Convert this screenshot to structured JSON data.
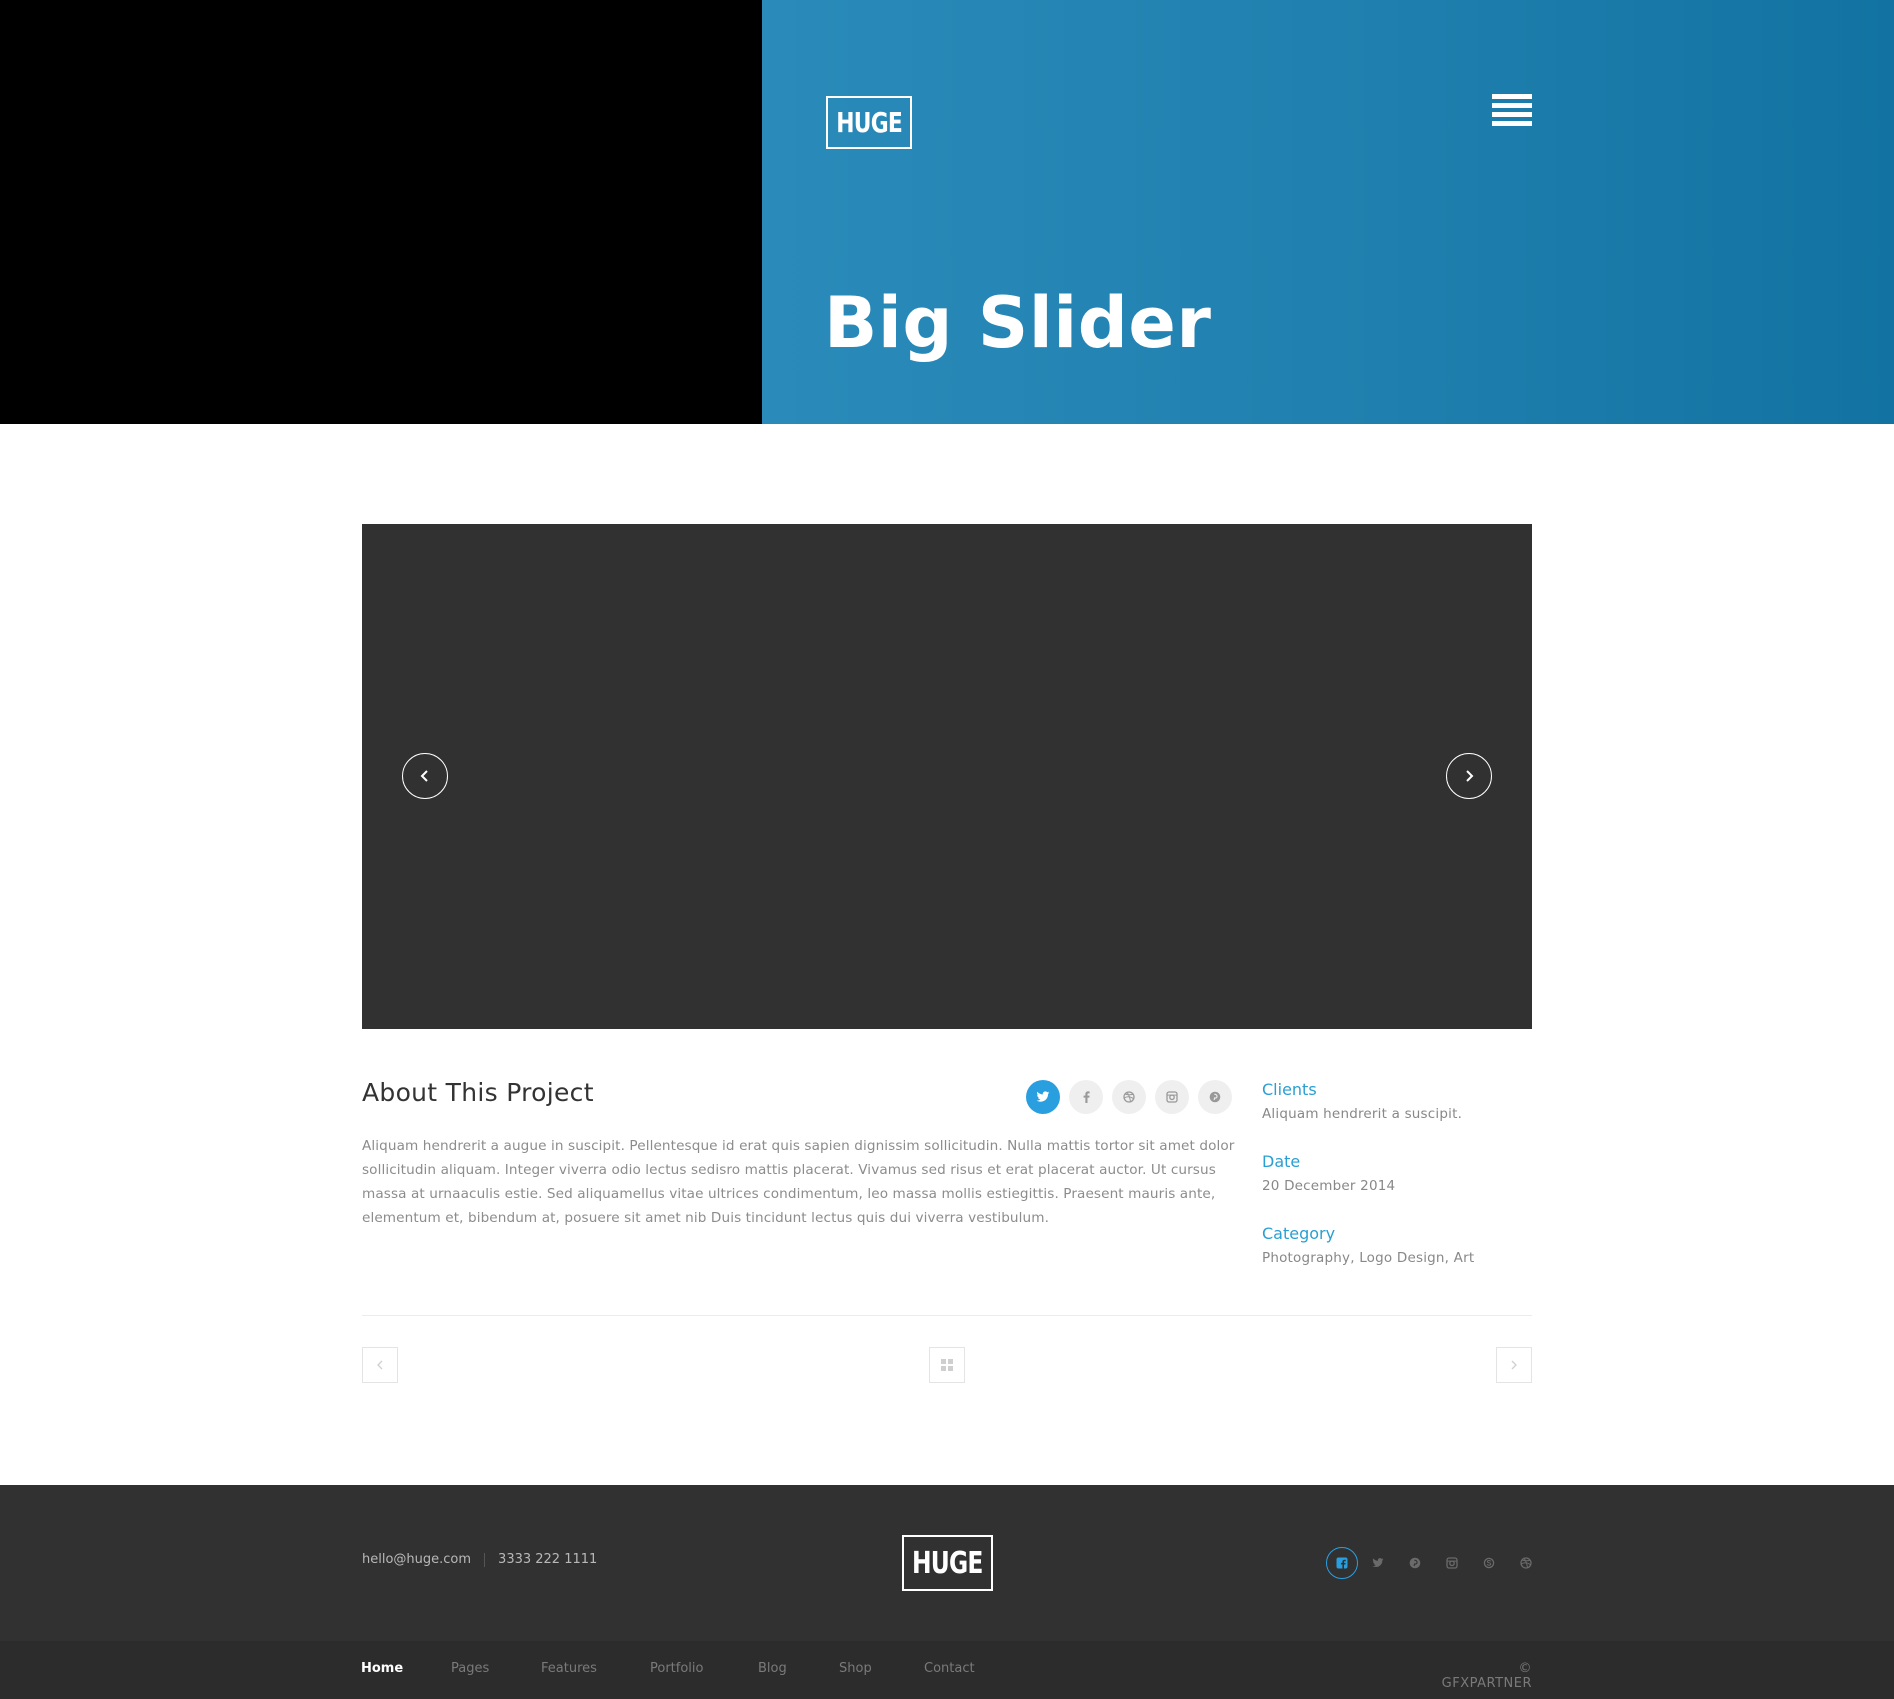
{
  "brand": {
    "logo_text": "HUGE"
  },
  "hero": {
    "title": "Big Slider"
  },
  "slider": {
    "prev_icon": "chevron-left-icon",
    "next_icon": "chevron-right-icon"
  },
  "about": {
    "title": "About This Project",
    "description": "Aliquam hendrerit a augue in suscipit. Pellentesque id erat quis sapien dignissim sollicitudin. Nulla mattis tortor sit amet dolor sollicitudin aliquam. Integer viverra odio lectus sedisro mattis placerat. Vivamus sed risus et erat placerat auctor. Ut cursus massa at urnaaculis estie. Sed aliquamellus vitae ultrices condimentum, leo massa mollis estiegittis. Praesent mauris ante, elementum et, bibendum at, posuere sit amet nib Duis tincidunt lectus quis dui viverra vestibulum.",
    "share_icons": [
      "twitter-icon",
      "facebook-icon",
      "dribbble-icon",
      "instagram-icon",
      "pinterest-icon"
    ],
    "meta": [
      {
        "label": "Clients",
        "value": "Aliquam hendrerit a suscipit."
      },
      {
        "label": "Date",
        "value": "20 December 2014"
      },
      {
        "label": "Category",
        "value": "Photography, Logo Design, Art"
      }
    ]
  },
  "project_nav": {
    "prev_icon": "chevron-left-icon",
    "grid_icon": "grid-icon",
    "next_icon": "chevron-right-icon"
  },
  "footer": {
    "email": "hello@huge.com",
    "phone": "3333 222 1111",
    "logo_text": "HUGE",
    "social_icons": [
      "facebook-icon",
      "twitter-icon",
      "pinterest-icon",
      "instagram-icon",
      "skype-icon",
      "dribbble-icon"
    ],
    "nav": [
      "Home",
      "Pages",
      "Features",
      "Portfolio",
      "Blog",
      "Shop",
      "Contact"
    ],
    "copyright": "© GFXPARTNER"
  },
  "colors": {
    "accent": "#2a9fd3",
    "hero_blue": "#1f7fae",
    "dark": "#313131"
  }
}
